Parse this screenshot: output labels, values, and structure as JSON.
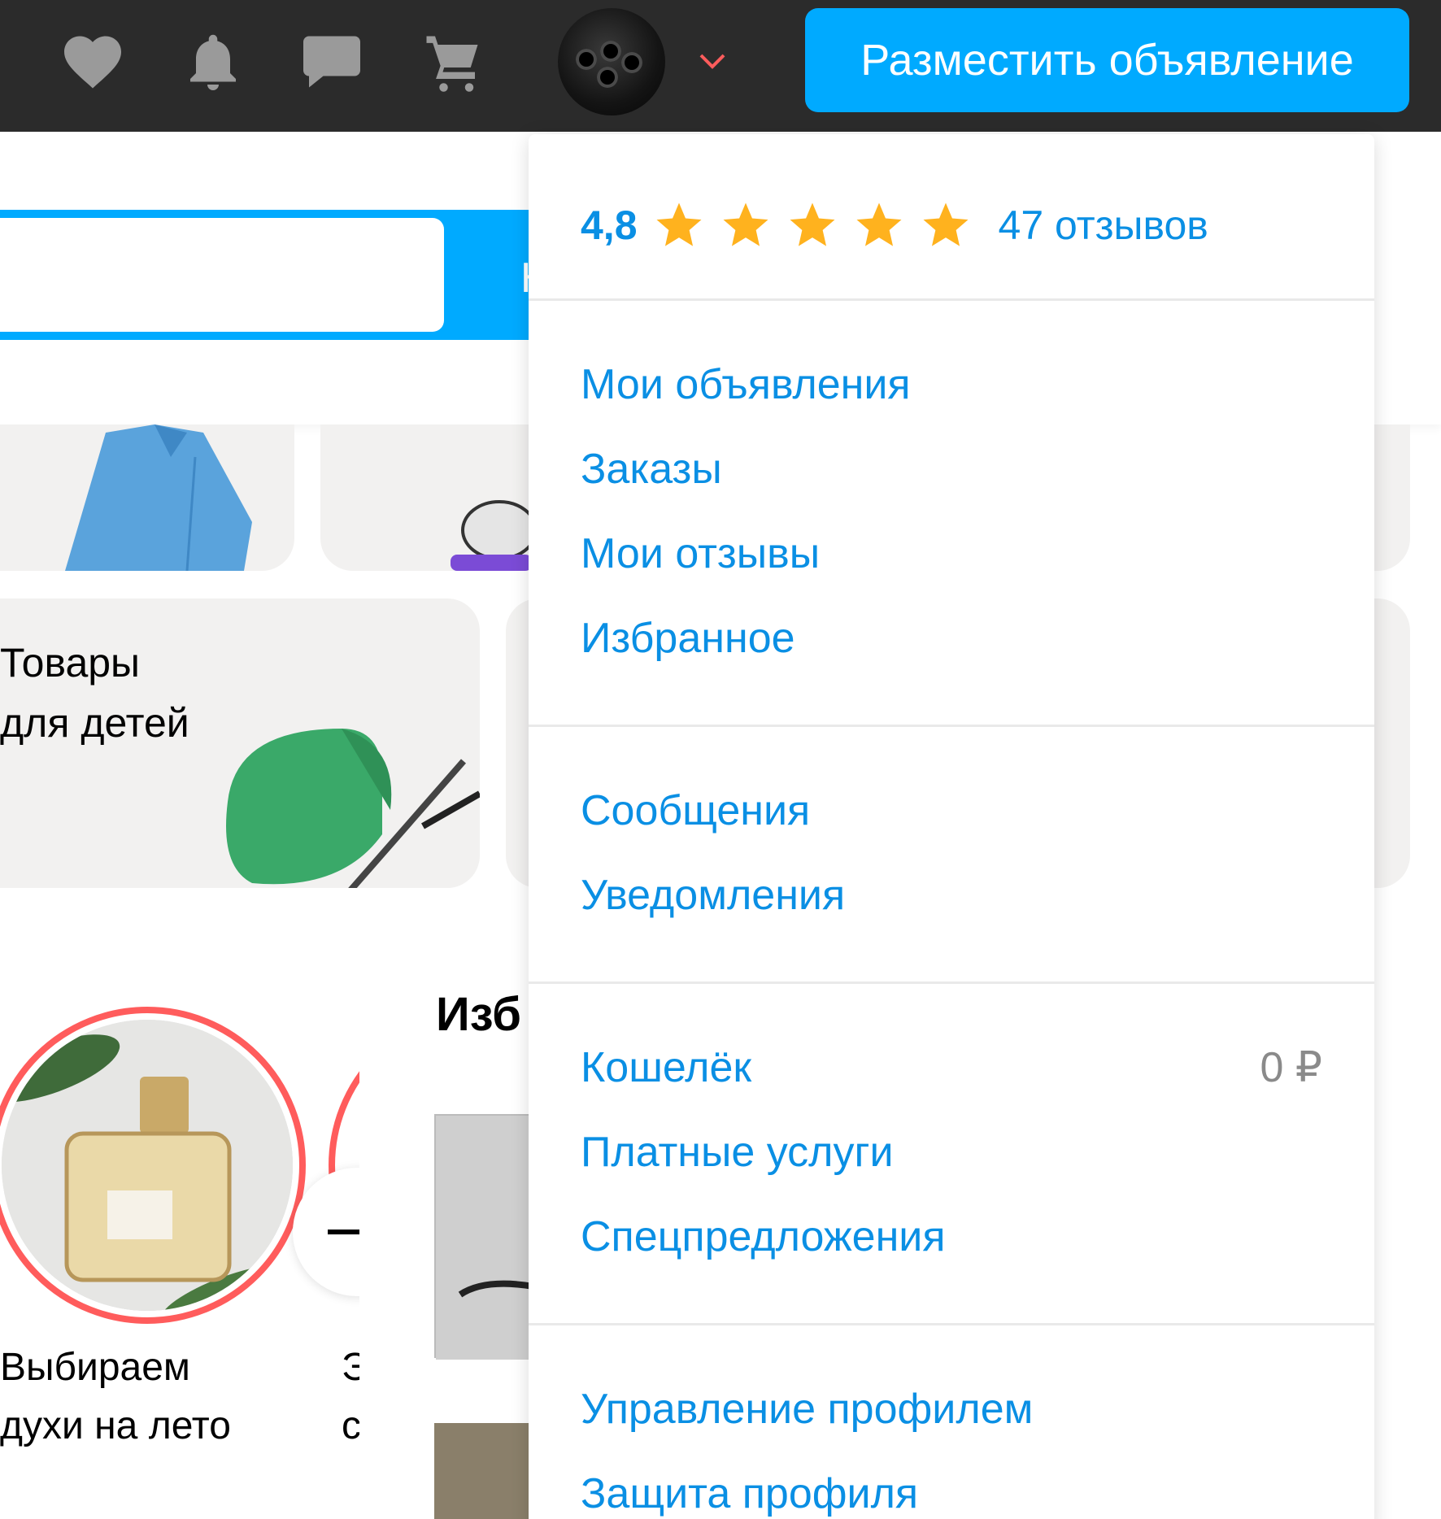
{
  "topbar": {
    "icons": [
      "heart-icon",
      "bell-icon",
      "chat-icon",
      "cart-icon"
    ],
    "post_button": "Разместить объявление"
  },
  "search": {
    "button_partial": "Н"
  },
  "categories": {
    "kids": "Товары для детей",
    "kids_line1": "Товары",
    "kids_line2": "для детей"
  },
  "stories": {
    "item1_line1": "Выбираем",
    "item1_line2": "духи на лето",
    "item2_line1": "Э",
    "item2_line2": "с"
  },
  "section": {
    "title_partial": "Изб"
  },
  "dropdown": {
    "rating": "4,8",
    "stars": 5,
    "reviews": "47 отзывов",
    "group1": [
      "Мои объявления",
      "Заказы",
      "Мои отзывы",
      "Избранное"
    ],
    "group2": [
      "Сообщения",
      "Уведомления"
    ],
    "group3": [
      "Кошелёк",
      "Платные услуги",
      "Спецпредложения"
    ],
    "wallet_amount": "0 ₽",
    "group4": [
      "Управление профилем",
      "Защита профиля"
    ]
  },
  "colors": {
    "topbar": "#2b2b2b",
    "accent": "#00aaff",
    "link": "#0a8fe4",
    "star": "#ffb21e",
    "story_ring": "#ff5c5c"
  }
}
